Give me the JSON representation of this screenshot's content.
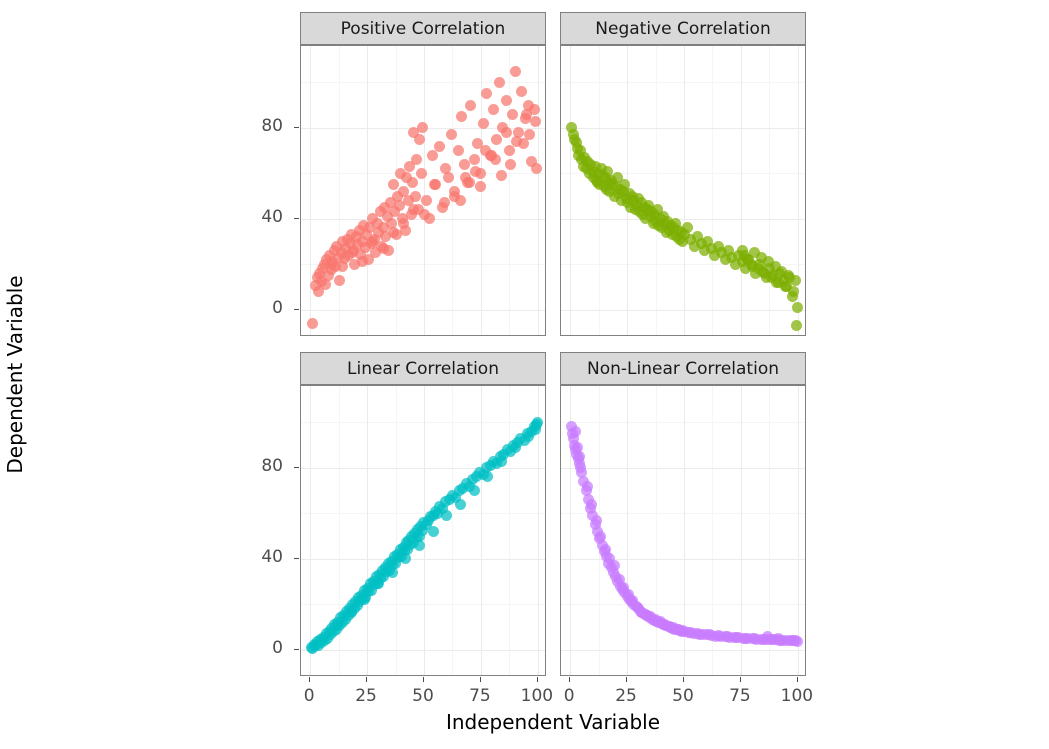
{
  "figure": {
    "x_axis_title": "Independent Variable",
    "y_axis_title": "Dependent Variable",
    "background_color": "#ffffff",
    "strip_background_color": "#d9d9d9",
    "panel_border_color": "#808080",
    "gridline_color": "#ebebeb"
  },
  "chart_data": [
    {
      "type": "scatter",
      "title": "Positive Correlation",
      "xlabel": "Independent Variable",
      "ylabel": "Dependent Variable",
      "color": "#F8766D",
      "xlim": [
        -4,
        104
      ],
      "ylim": [
        -12,
        116
      ],
      "xticks": [
        0,
        25,
        50,
        75,
        100
      ],
      "yticks": [
        0,
        40,
        80
      ],
      "grid": true,
      "legend": "none",
      "x": [
        1.2,
        2.4,
        3.1,
        3.6,
        4.2,
        5.0,
        5.5,
        6.1,
        6.8,
        7.3,
        8.0,
        8.6,
        9.2,
        9.9,
        10.5,
        11.2,
        11.8,
        12.5,
        13.1,
        13.8,
        14.4,
        15.1,
        15.7,
        16.4,
        17.0,
        17.7,
        18.3,
        19.0,
        19.6,
        20.3,
        20.9,
        21.6,
        22.2,
        22.9,
        23.5,
        24.2,
        24.8,
        25.5,
        26.1,
        26.8,
        27.4,
        28.1,
        28.7,
        29.4,
        30.0,
        30.7,
        31.3,
        32.0,
        32.6,
        33.3,
        33.9,
        34.6,
        35.2,
        35.9,
        36.5,
        37.2,
        37.8,
        38.5,
        39.1,
        39.8,
        40.4,
        41.1,
        41.7,
        42.4,
        43.0,
        43.7,
        44.3,
        45.0,
        45.6,
        46.3,
        46.9,
        47.6,
        48.2,
        48.9,
        49.5,
        51.0,
        52.4,
        53.8,
        55.2,
        56.6,
        58.0,
        59.4,
        60.8,
        62.2,
        63.6,
        65.0,
        66.4,
        67.8,
        69.2,
        70.6,
        72.0,
        73.4,
        74.8,
        76.2,
        77.6,
        79.0,
        80.4,
        81.8,
        83.2,
        84.6,
        86.0,
        87.4,
        88.8,
        90.2,
        91.6,
        93.0,
        94.4,
        95.8,
        97.2,
        98.6,
        9.5,
        14.0,
        18.5,
        23.0,
        27.5,
        32.0,
        36.5,
        41.0,
        45.5,
        50.0,
        54.5,
        59.0,
        63.5,
        68.0,
        72.5,
        77.0,
        81.5,
        86.0,
        90.5,
        95.0,
        99.0,
        99.5,
        96.5,
        93.5,
        88.0,
        84.0,
        79.5,
        75.0,
        70.0,
        66.0
      ],
      "y": [
        -6.0,
        10.5,
        14.0,
        8.0,
        16.0,
        12.5,
        18.0,
        20.0,
        11.0,
        22.0,
        15.0,
        24.0,
        17.5,
        21.0,
        26.0,
        19.0,
        28.0,
        23.0,
        13.0,
        25.0,
        30.0,
        22.5,
        27.0,
        31.0,
        24.0,
        29.0,
        33.0,
        26.0,
        20.0,
        32.0,
        28.5,
        35.0,
        24.5,
        30.0,
        37.0,
        27.5,
        33.0,
        22.0,
        36.0,
        29.0,
        40.0,
        31.0,
        25.0,
        38.0,
        34.0,
        43.0,
        28.0,
        36.0,
        45.0,
        32.0,
        41.0,
        26.0,
        47.0,
        38.0,
        55.0,
        43.0,
        33.0,
        50.0,
        46.0,
        60.0,
        40.0,
        52.0,
        35.0,
        58.0,
        48.0,
        63.0,
        42.0,
        56.0,
        78.0,
        50.0,
        66.0,
        44.0,
        75.0,
        60.0,
        80.0,
        48.0,
        40.0,
        68.0,
        55.0,
        72.0,
        45.0,
        62.0,
        58.0,
        77.0,
        50.0,
        70.0,
        85.0,
        64.0,
        56.0,
        90.0,
        66.0,
        73.0,
        60.0,
        82.0,
        95.0,
        68.0,
        88.0,
        75.0,
        100.0,
        80.0,
        92.0,
        70.0,
        86.0,
        105.0,
        78.0,
        96.0,
        84.0,
        90.0,
        65.0,
        88.0,
        20.0,
        19.0,
        25.0,
        21.0,
        30.0,
        27.0,
        34.0,
        38.0,
        44.0,
        42.0,
        55.0,
        47.0,
        52.0,
        58.0,
        61.0,
        70.0,
        66.0,
        78.0,
        74.0,
        86.0,
        83.0,
        62.0,
        77.0,
        73.0,
        64.0,
        59.0,
        68.0,
        54.0,
        56.0,
        48.0
      ]
    },
    {
      "type": "scatter",
      "title": "Negative Correlation",
      "xlabel": "Independent Variable",
      "ylabel": "Dependent Variable",
      "color": "#7CAE00",
      "xlim": [
        -4,
        104
      ],
      "ylim": [
        -12,
        116
      ],
      "xticks": [
        0,
        25,
        50,
        75,
        100
      ],
      "yticks": [
        0,
        40,
        80
      ],
      "grid": true,
      "legend": "none",
      "x": [
        0.8,
        1.5,
        2.0,
        2.6,
        3.2,
        3.9,
        4.5,
        5.2,
        5.8,
        6.5,
        7.1,
        7.8,
        8.4,
        9.1,
        9.7,
        10.4,
        11.0,
        11.7,
        12.3,
        13.0,
        13.6,
        14.3,
        14.9,
        15.6,
        16.2,
        16.9,
        17.5,
        18.2,
        18.8,
        19.5,
        20.1,
        20.8,
        21.4,
        22.1,
        22.7,
        23.4,
        24.0,
        24.7,
        25.3,
        26.0,
        26.6,
        27.3,
        27.9,
        28.6,
        29.2,
        29.9,
        30.5,
        31.2,
        31.8,
        32.5,
        33.1,
        33.8,
        34.4,
        35.1,
        35.7,
        36.4,
        37.0,
        37.7,
        38.3,
        39.0,
        39.6,
        40.3,
        40.9,
        41.6,
        42.2,
        42.9,
        43.5,
        44.2,
        44.8,
        45.5,
        46.1,
        46.8,
        47.4,
        48.1,
        48.7,
        49.4,
        50.0,
        51.5,
        53.0,
        54.5,
        56.0,
        57.5,
        59.0,
        60.5,
        62.0,
        63.5,
        65.0,
        66.5,
        68.0,
        69.5,
        71.0,
        72.5,
        74.0,
        75.5,
        77.0,
        78.5,
        80.0,
        81.5,
        83.0,
        84.5,
        86.0,
        87.5,
        89.0,
        90.5,
        92.0,
        93.5,
        95.0,
        96.5,
        98.0,
        99.5,
        75.5,
        76.5,
        78.0,
        79.5,
        81.0,
        82.5,
        84.0,
        85.5,
        87.0,
        88.5,
        90.0,
        91.5,
        93.0,
        94.5,
        96.0,
        97.5,
        99.0,
        100.0,
        12.0,
        16.0
      ],
      "y": [
        80.0,
        77.0,
        75.0,
        73.5,
        71.0,
        68.0,
        70.0,
        66.0,
        63.0,
        67.0,
        62.0,
        65.0,
        60.0,
        64.0,
        61.0,
        58.0,
        63.0,
        57.0,
        60.0,
        55.0,
        62.0,
        59.0,
        54.0,
        58.0,
        61.0,
        56.0,
        52.0,
        57.0,
        55.0,
        50.0,
        54.0,
        58.0,
        51.0,
        53.0,
        48.0,
        52.0,
        55.0,
        49.0,
        47.0,
        51.0,
        45.0,
        50.0,
        48.0,
        44.0,
        46.0,
        49.0,
        43.0,
        47.0,
        42.0,
        45.0,
        40.0,
        44.0,
        46.0,
        41.0,
        43.0,
        38.0,
        42.0,
        39.0,
        44.0,
        37.0,
        40.0,
        36.0,
        41.0,
        38.0,
        34.0,
        39.0,
        35.0,
        37.0,
        33.0,
        36.0,
        38.0,
        32.0,
        35.0,
        31.0,
        34.0,
        30.0,
        33.0,
        36.0,
        31.0,
        28.0,
        32.0,
        29.0,
        26.0,
        30.0,
        27.0,
        24.0,
        28.0,
        25.0,
        22.0,
        26.0,
        23.0,
        20.0,
        24.0,
        21.0,
        18.0,
        22.0,
        19.0,
        16.0,
        20.0,
        17.0,
        14.0,
        18.0,
        15.0,
        12.0,
        16.0,
        13.0,
        10.0,
        14.0,
        8.0,
        -7.0,
        26.0,
        24.0,
        22.0,
        20.0,
        25.0,
        18.0,
        23.0,
        16.0,
        21.0,
        14.0,
        19.0,
        12.0,
        17.0,
        10.0,
        15.0,
        6.0,
        13.0,
        1.0,
        56.0,
        53.0
      ]
    },
    {
      "type": "scatter",
      "title": "Linear Correlation",
      "xlabel": "Independent Variable",
      "ylabel": "Dependent Variable",
      "color": "#00BFC4",
      "xlim": [
        -4,
        104
      ],
      "ylim": [
        -12,
        116
      ],
      "xticks": [
        0,
        25,
        50,
        75,
        100
      ],
      "yticks": [
        0,
        40,
        80
      ],
      "grid": true,
      "legend": "none",
      "x": [
        0.5,
        1.1,
        1.8,
        2.4,
        3.1,
        3.7,
        4.4,
        5.0,
        5.7,
        6.3,
        7.0,
        7.6,
        8.3,
        8.9,
        9.6,
        10.2,
        10.9,
        11.5,
        12.2,
        12.8,
        13.5,
        14.1,
        14.8,
        15.4,
        16.1,
        16.7,
        17.4,
        18.0,
        18.7,
        19.3,
        20.0,
        20.6,
        21.3,
        21.9,
        22.6,
        23.2,
        23.9,
        24.5,
        25.2,
        25.8,
        26.5,
        27.1,
        27.8,
        28.4,
        29.1,
        29.7,
        30.4,
        31.0,
        31.7,
        32.3,
        33.0,
        33.6,
        34.3,
        34.9,
        35.6,
        36.2,
        36.9,
        37.5,
        38.2,
        38.8,
        39.5,
        40.1,
        40.8,
        41.4,
        42.1,
        42.7,
        43.4,
        44.0,
        44.7,
        45.3,
        46.0,
        46.6,
        47.3,
        47.9,
        48.6,
        49.2,
        49.9,
        51.0,
        52.0,
        53.0,
        54.0,
        55.0,
        56.0,
        57.0,
        58.0,
        59.5,
        61.0,
        62.5,
        64.0,
        65.5,
        67.0,
        68.5,
        70.0,
        71.5,
        73.0,
        74.5,
        76.0,
        77.5,
        79.0,
        80.5,
        82.0,
        83.5,
        85.0,
        86.5,
        88.0,
        89.5,
        91.0,
        92.5,
        94.0,
        95.5,
        97.0,
        98.5,
        99.5,
        100.0,
        12.0,
        18.0,
        24.0,
        30.0,
        36.0,
        42.0,
        48.0,
        54.0,
        60.0,
        66.0,
        72.0,
        78.0,
        84.0,
        90.0,
        96.0,
        99.0
      ],
      "y": [
        1.0,
        0.5,
        2.5,
        1.8,
        3.5,
        2.0,
        4.5,
        3.0,
        5.5,
        4.0,
        7.0,
        5.0,
        8.0,
        6.5,
        9.5,
        8.0,
        11.0,
        9.0,
        12.0,
        10.5,
        14.0,
        12.0,
        15.0,
        13.5,
        17.0,
        15.0,
        18.0,
        16.5,
        20.0,
        18.0,
        21.0,
        19.5,
        23.0,
        21.0,
        24.0,
        22.5,
        26.0,
        23.0,
        27.0,
        25.5,
        29.0,
        26.0,
        30.0,
        28.5,
        32.0,
        29.0,
        33.0,
        31.5,
        35.0,
        32.0,
        36.0,
        34.5,
        38.0,
        35.0,
        39.0,
        37.5,
        41.0,
        38.0,
        42.0,
        40.5,
        44.0,
        41.0,
        45.0,
        43.5,
        47.0,
        44.0,
        48.0,
        46.5,
        50.0,
        47.0,
        51.0,
        49.5,
        53.0,
        50.0,
        54.0,
        52.5,
        56.0,
        55.0,
        57.0,
        58.5,
        59.0,
        61.0,
        60.0,
        63.0,
        62.0,
        65.0,
        66.0,
        68.0,
        67.0,
        70.0,
        71.0,
        73.0,
        72.0,
        75.0,
        76.0,
        78.0,
        77.0,
        80.0,
        81.0,
        83.0,
        82.0,
        85.0,
        86.0,
        88.0,
        87.0,
        90.0,
        91.0,
        93.0,
        92.0,
        95.0,
        96.0,
        98.0,
        99.0,
        100.0,
        11.0,
        17.0,
        22.0,
        29.0,
        34.0,
        40.0,
        46.0,
        52.0,
        59.0,
        64.0,
        70.0,
        76.0,
        83.0,
        89.0,
        94.0,
        97.0
      ]
    },
    {
      "type": "scatter",
      "title": "Non-Linear Correlation",
      "xlabel": "Independent Variable",
      "ylabel": "Dependent Variable",
      "color": "#C77CFF",
      "xlim": [
        -4,
        104
      ],
      "ylim": [
        -12,
        116
      ],
      "xticks": [
        0,
        25,
        50,
        75,
        100
      ],
      "yticks": [
        0,
        40,
        80
      ],
      "grid": true,
      "legend": "none",
      "x": [
        0.5,
        1.0,
        1.5,
        2.0,
        2.5,
        3.0,
        3.5,
        4.0,
        4.5,
        5.0,
        6.0,
        7.0,
        8.0,
        9.0,
        10.0,
        11.0,
        12.0,
        13.0,
        14.0,
        15.0,
        16.0,
        17.0,
        18.0,
        19.0,
        20.0,
        21.0,
        22.0,
        23.0,
        24.0,
        25.0,
        26.0,
        27.0,
        28.0,
        29.0,
        30.0,
        31.0,
        32.0,
        33.0,
        34.0,
        35.0,
        36.0,
        37.0,
        38.0,
        39.0,
        40.0,
        41.0,
        42.0,
        43.0,
        44.0,
        45.0,
        46.0,
        47.0,
        48.0,
        49.0,
        50.0,
        52.0,
        54.0,
        56.0,
        58.0,
        60.0,
        62.0,
        64.0,
        66.0,
        68.0,
        70.0,
        72.0,
        74.0,
        76.0,
        78.0,
        80.0,
        82.0,
        84.0,
        86.0,
        88.0,
        90.0,
        92.0,
        94.0,
        96.0,
        98.0,
        100.0,
        2.2,
        3.2,
        4.2,
        7.5,
        9.5,
        11.5,
        13.5,
        15.5,
        17.5,
        19.5,
        21.5,
        23.5,
        25.5,
        27.5,
        29.5,
        31.5,
        33.5,
        35.5,
        37.5,
        39.5,
        41.5,
        43.5,
        45.5,
        47.5,
        49.5,
        53.0,
        57.0,
        61.0,
        65.0,
        69.0,
        73.0,
        77.0,
        81.0,
        85.0,
        89.0,
        93.0,
        97.0,
        99.0,
        86.5,
        91.5
      ],
      "y": [
        98.0,
        95.0,
        93.0,
        90.0,
        88.0,
        86.0,
        84.0,
        82.0,
        80.0,
        78.0,
        74.0,
        70.0,
        66.0,
        62.0,
        59.0,
        55.0,
        52.0,
        49.0,
        46.0,
        43.0,
        41.0,
        38.0,
        36.0,
        34.0,
        32.0,
        30.0,
        28.0,
        26.5,
        25.0,
        23.5,
        22.0,
        21.0,
        20.0,
        19.0,
        18.0,
        17.0,
        16.0,
        15.5,
        15.0,
        14.0,
        13.5,
        13.0,
        12.5,
        12.0,
        11.5,
        11.0,
        10.5,
        10.0,
        9.8,
        9.5,
        9.0,
        8.8,
        8.5,
        8.2,
        8.0,
        7.5,
        7.2,
        7.0,
        6.8,
        6.5,
        6.2,
        6.0,
        5.8,
        5.6,
        5.5,
        5.3,
        5.2,
        5.0,
        4.9,
        4.8,
        4.7,
        4.6,
        4.5,
        4.4,
        4.3,
        4.2,
        4.1,
        4.0,
        3.9,
        3.8,
        96.0,
        89.0,
        85.0,
        72.0,
        64.0,
        57.0,
        50.0,
        44.0,
        40.0,
        37.0,
        31.0,
        27.5,
        24.5,
        21.5,
        18.5,
        16.5,
        15.2,
        14.5,
        13.2,
        12.2,
        11.2,
        10.2,
        9.6,
        8.9,
        8.4,
        7.4,
        6.9,
        6.6,
        6.1,
        5.7,
        5.4,
        5.1,
        4.85,
        4.65,
        4.45,
        4.25,
        4.05,
        3.85,
        6.0,
        5.0
      ]
    }
  ],
  "panels": [
    {
      "strip_label": "Positive Correlation"
    },
    {
      "strip_label": "Negative Correlation"
    },
    {
      "strip_label": "Linear Correlation"
    },
    {
      "strip_label": "Non-Linear Correlation"
    }
  ],
  "axes": {
    "x_tick_labels": [
      "0",
      "25",
      "50",
      "75",
      "100"
    ],
    "y_tick_labels": [
      "0",
      "40",
      "80"
    ]
  }
}
